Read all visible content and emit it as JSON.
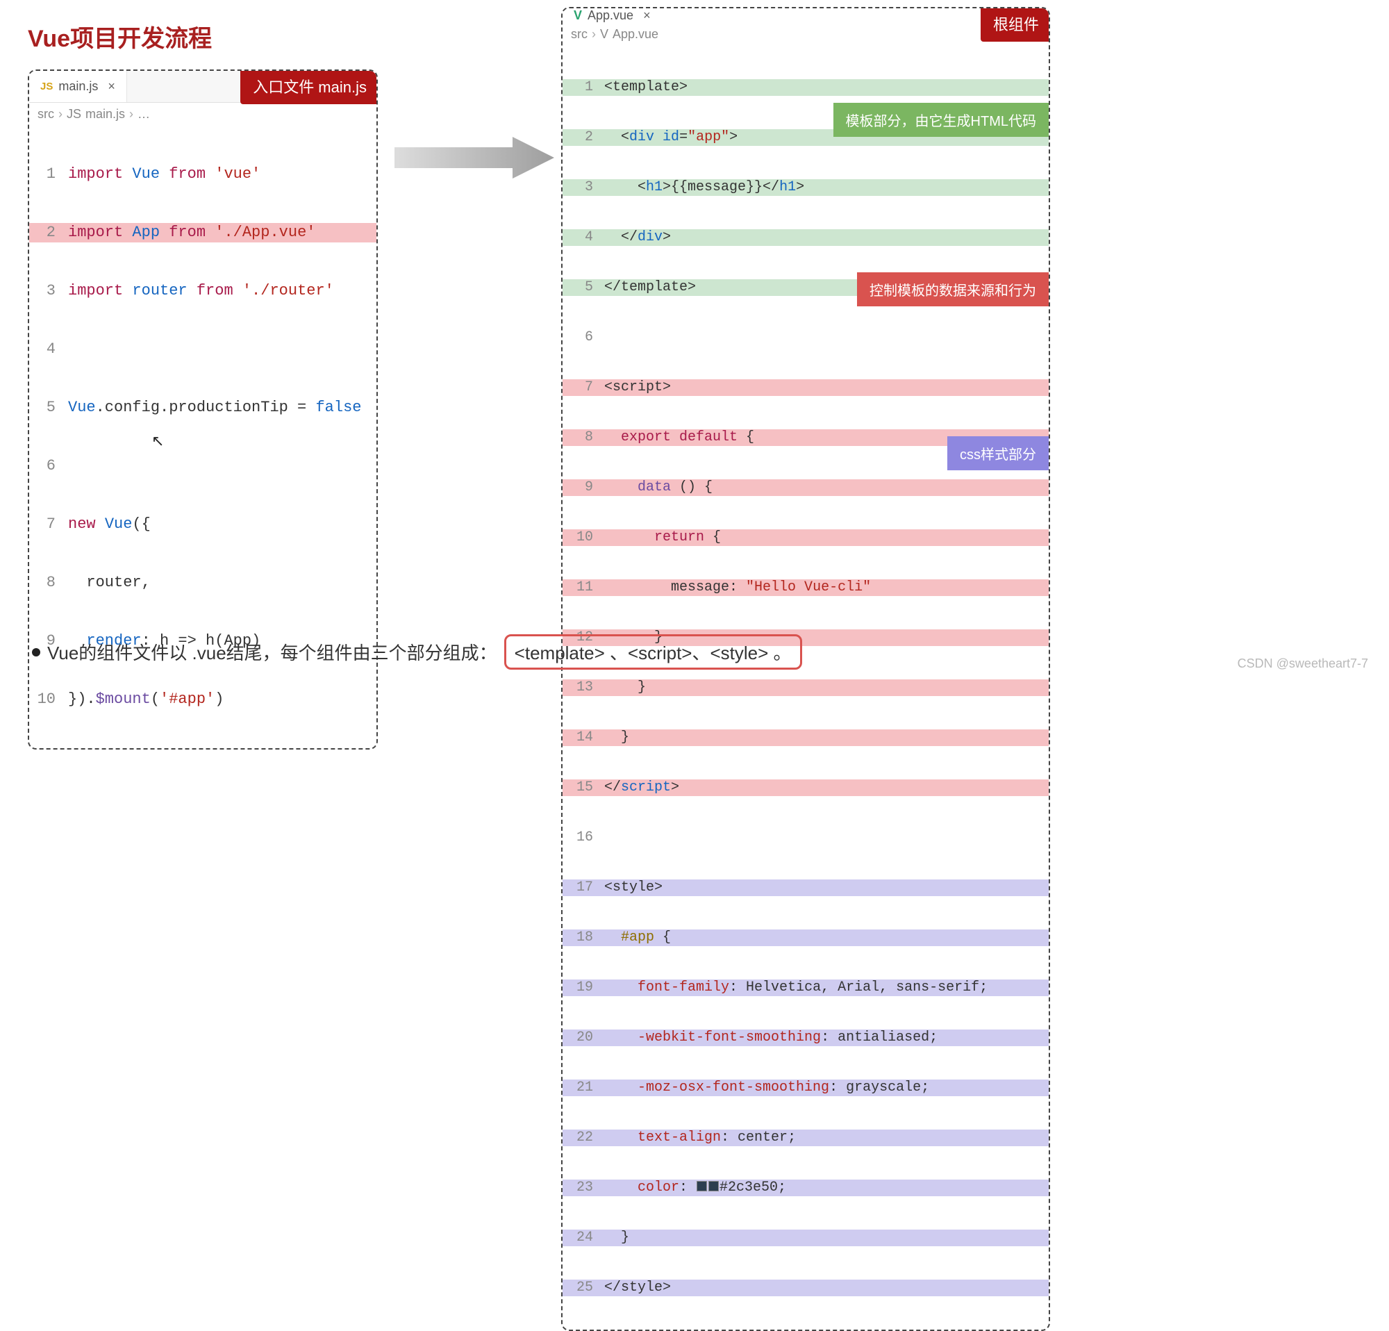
{
  "title": "Vue项目开发流程",
  "left": {
    "tab_icon": "JS",
    "tab_name": "main.js",
    "badge": "入口文件 main.js",
    "crumbs": {
      "dir": "src",
      "icon": "JS",
      "file": "main.js",
      "tail": "…"
    },
    "lines": {
      "1": {
        "a": "import",
        "b": "Vue",
        "c": "from",
        "d": "'vue'"
      },
      "2": {
        "a": "import",
        "b": "App",
        "c": "from",
        "d": "'./App.vue'"
      },
      "3": {
        "a": "import",
        "b": "router",
        "c": "from",
        "d": "'./router'"
      },
      "5": {
        "a": "Vue",
        "b": ".config.productionTip = ",
        "c": "false"
      },
      "7": {
        "a": "new",
        "b": "Vue",
        "c": "({"
      },
      "8": "  router,",
      "9": {
        "a": "  render",
        "b": ": h => h(App)"
      },
      "10": {
        "a": "}).",
        "b": "$mount",
        "c": "(",
        "d": "'#app'",
        "e": ")"
      }
    }
  },
  "right": {
    "tab_icon": "V",
    "tab_name": "App.vue",
    "badge": "根组件",
    "crumbs": {
      "dir": "src",
      "icon": "V",
      "file": "App.vue"
    },
    "ann_template": "模板部分，由它生成HTML代码",
    "ann_script": "控制模板的数据来源和行为",
    "ann_style": "css样式部分",
    "lines": {
      "1": "<template>",
      "2": {
        "a": "  <",
        "b": "div",
        "c": " ",
        "d": "id",
        "e": "=",
        "f": "\"app\"",
        "g": ">"
      },
      "3": {
        "a": "    <",
        "b": "h1",
        "c": ">{{message}}</",
        "d": "h1",
        "e": ">"
      },
      "4": {
        "a": "  </",
        "b": "div",
        "c": ">"
      },
      "5": "</template>",
      "7": "<script>",
      "8": {
        "a": "  export",
        "b": " default",
        "c": " {"
      },
      "9": {
        "a": "    ",
        "b": "data",
        "c": " () {"
      },
      "10": {
        "a": "      ",
        "b": "return",
        "c": " {"
      },
      "11": {
        "a": "        message: ",
        "b": "\"Hello Vue-cli\""
      },
      "12": "      }",
      "13": "    }",
      "14": "  }",
      "15": {
        "a": "</",
        "b": "script",
        "c": ">"
      },
      "17": "<style>",
      "18": {
        "a": "  ",
        "b": "#app",
        "c": " {"
      },
      "19": {
        "a": "    ",
        "b": "font-family",
        "c": ": Helvetica, Arial, sans-serif;"
      },
      "20": {
        "a": "    ",
        "b": "-webkit-font-smoothing",
        "c": ": antialiased;"
      },
      "21": {
        "a": "    ",
        "b": "-moz-osx-font-smoothing",
        "c": ": grayscale;"
      },
      "22": {
        "a": "    ",
        "b": "text-align",
        "c": ": center;"
      },
      "23": {
        "a": "    ",
        "b": "color",
        "c": ": ",
        "d": "#2c3e50;"
      },
      "24": "  }",
      "25": "</style>"
    }
  },
  "footer": {
    "lead": "Vue的组件文件以 .vue结尾，每个组件由三个部分组成：",
    "box": "<template> 、<script>、<style> 。"
  },
  "watermark": "CSDN @sweetheart7-7"
}
